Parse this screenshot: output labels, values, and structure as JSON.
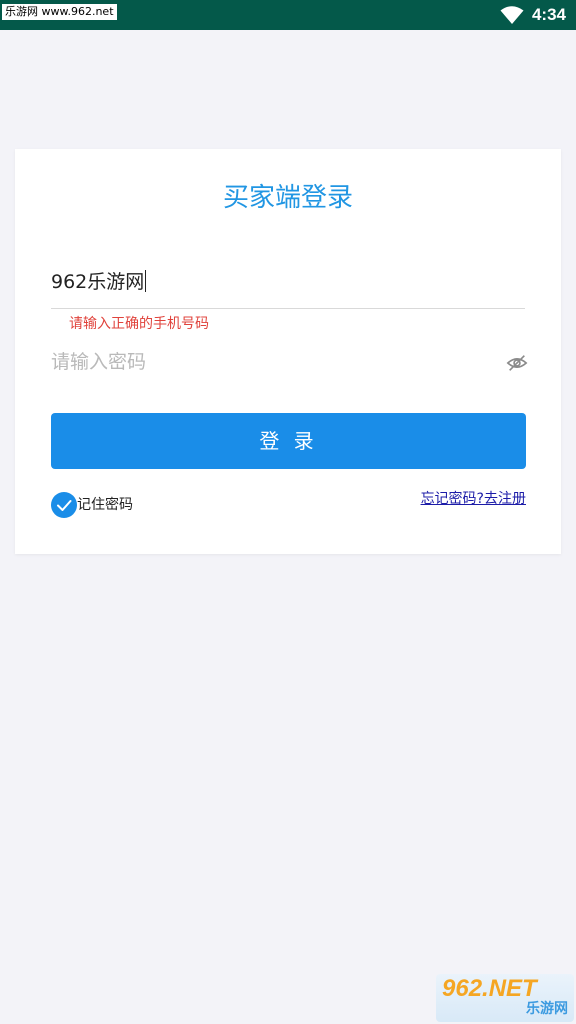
{
  "status_bar": {
    "watermark": "乐游网 www.962.net",
    "time": "4:34",
    "background": "#04594a"
  },
  "login": {
    "title": "买家端登录",
    "phone_value": "962乐游网",
    "phone_error": "请输入正确的手机号码",
    "password_placeholder": "请输入密码",
    "password_icon": "eye-off-icon",
    "login_label": "登 录",
    "remember_label": "记住密码",
    "remember_checked": true,
    "forgot_register_label": "忘记密码?去注册"
  },
  "watermark_bottom": {
    "main": "962.NET",
    "sub": "乐游网"
  },
  "colors": {
    "accent": "#1a8de8",
    "title": "#2196e3",
    "error": "#e0433c",
    "link": "#1c1ca8",
    "page_background": "#f3f3f8"
  }
}
